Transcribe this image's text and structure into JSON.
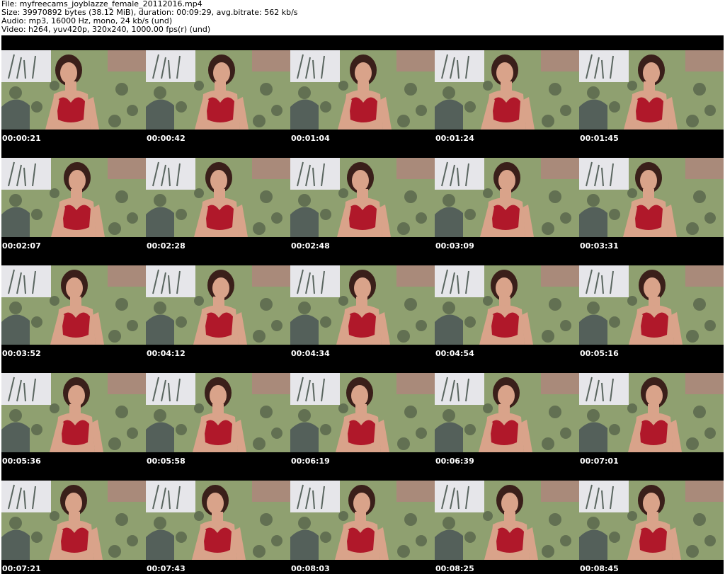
{
  "header": {
    "file_line": "File: myfreecams_joyblazze_female_20112016.mp4",
    "size_line": "Size: 39970892 bytes (38.12 MiB), duration: 00:09:29, avg.bitrate: 562 kb/s",
    "audio_line": "Audio: mp3, 16000 Hz, mono, 24 kb/s (und)",
    "video_line": "Video: h264, yuv420p, 320x240, 1000.00 fps(r) (und)"
  },
  "colors": {
    "background": "#ffffff",
    "sheet": "#000000",
    "timestamp_text": "#ffffff",
    "couch_green": "#8fa070",
    "couch_dark": "#3f4a3a",
    "wall": "#e6e6ea",
    "top": "#b0182a",
    "skin": "#d9a38a",
    "hair": "#3a1f1a"
  },
  "thumbnails": [
    {
      "time": "00:00:21"
    },
    {
      "time": "00:00:42"
    },
    {
      "time": "00:01:04"
    },
    {
      "time": "00:01:24"
    },
    {
      "time": "00:01:45"
    },
    {
      "time": "00:02:07"
    },
    {
      "time": "00:02:28"
    },
    {
      "time": "00:02:48"
    },
    {
      "time": "00:03:09"
    },
    {
      "time": "00:03:31"
    },
    {
      "time": "00:03:52"
    },
    {
      "time": "00:04:12"
    },
    {
      "time": "00:04:34"
    },
    {
      "time": "00:04:54"
    },
    {
      "time": "00:05:16"
    },
    {
      "time": "00:05:36"
    },
    {
      "time": "00:05:58"
    },
    {
      "time": "00:06:19"
    },
    {
      "time": "00:06:39"
    },
    {
      "time": "00:07:01"
    },
    {
      "time": "00:07:21"
    },
    {
      "time": "00:07:43"
    },
    {
      "time": "00:08:03"
    },
    {
      "time": "00:08:25"
    },
    {
      "time": "00:08:45"
    }
  ]
}
